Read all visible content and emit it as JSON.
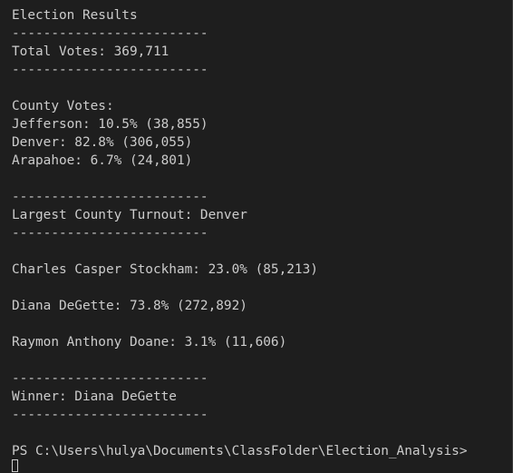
{
  "terminal": {
    "lines": [
      "Election Results",
      "-------------------------",
      "Total Votes: 369,711",
      "-------------------------",
      "",
      "County Votes:",
      "Jefferson: 10.5% (38,855)",
      "Denver: 82.8% (306,055)",
      "Arapahoe: 6.7% (24,801)",
      "",
      "-------------------------",
      "Largest County Turnout: Denver",
      "-------------------------",
      "",
      "Charles Casper Stockham: 23.0% (85,213)",
      "",
      "Diana DeGette: 73.8% (272,892)",
      "",
      "Raymon Anthony Doane: 3.1% (11,606)",
      "",
      "-------------------------",
      "Winner: Diana DeGette",
      "-------------------------",
      "",
      "PS C:\\Users\\hulya\\Documents\\ClassFolder\\Election_Analysis>"
    ]
  }
}
